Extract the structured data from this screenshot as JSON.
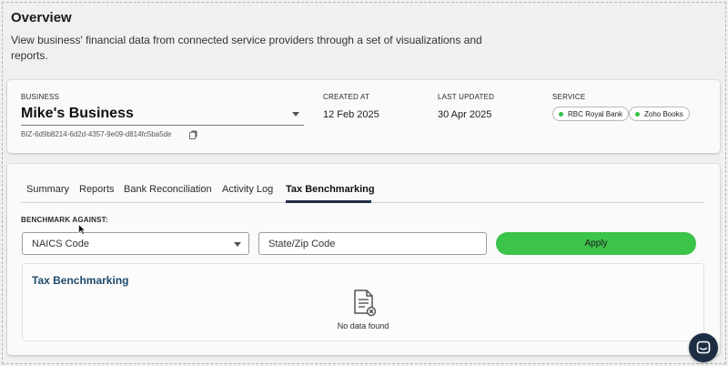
{
  "header": {
    "title": "Overview",
    "description": "View business' financial data from connected service providers through a set of visualizations and reports."
  },
  "business": {
    "label": "BUSINESS",
    "name": "Mike's Business",
    "id": "BIZ-6d9b8214-6d2d-4357-9e09-d814fc5ba5de",
    "created_label": "CREATED AT",
    "created_value": "12 Feb 2025",
    "updated_label": "LAST UPDATED",
    "updated_value": "30 Apr 2025",
    "service_label": "SERVICE",
    "services": [
      "RBC Royal Bank",
      "Zoho Books"
    ]
  },
  "tabs": [
    "Summary",
    "Reports",
    "Bank Reconciliation",
    "Activity Log",
    "Tax Benchmarking"
  ],
  "active_tab": "Tax Benchmarking",
  "benchmark": {
    "label": "BENCHMARK AGAINST:",
    "naics_placeholder": "NAICS Code",
    "zip_placeholder": "State/Zip Code",
    "apply_label": "Apply"
  },
  "results": {
    "title": "Tax Benchmarking",
    "empty_text": "No data found"
  },
  "colors": {
    "accent_green": "#3cc34a",
    "dark_navy": "#1c2d44",
    "results_title": "#1f4a6b"
  }
}
